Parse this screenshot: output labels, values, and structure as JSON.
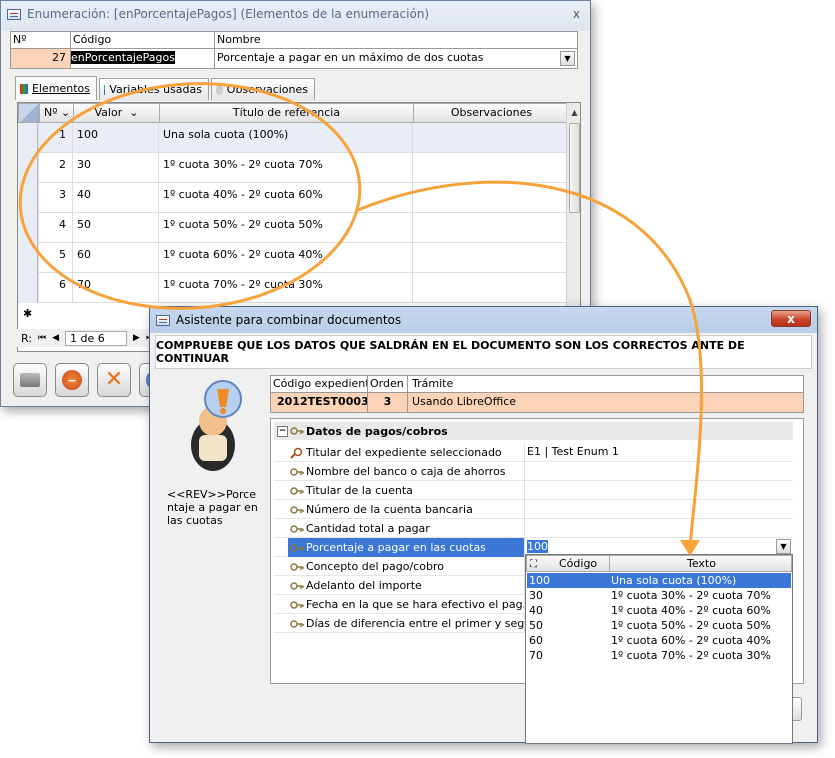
{
  "win1": {
    "title": "Enumeración: [enPorcentajePagos] (Elementos de la enumeración)",
    "close": "x",
    "header_cols": [
      "Nº",
      "Código",
      "Nombre"
    ],
    "record": {
      "num": "27",
      "code": "enPorcentajePagos",
      "name": "Porcentaje a pagar en un máximo de dos cuotas"
    },
    "tabs": [
      "Elementos",
      "Variables usadas",
      "Observaciones"
    ],
    "grid_cols": [
      "Nº",
      "Valor",
      "Título de referencia",
      "Observaciones"
    ],
    "rows": [
      {
        "n": "1",
        "valor": "100",
        "titulo": "Una sola cuota (100%)"
      },
      {
        "n": "2",
        "valor": "30",
        "titulo": "1º cuota 30% - 2º cuota 70%"
      },
      {
        "n": "3",
        "valor": "40",
        "titulo": "1º cuota 40% - 2º cuota 60%"
      },
      {
        "n": "4",
        "valor": "50",
        "titulo": "1º cuota 50% - 2º cuota 50%"
      },
      {
        "n": "5",
        "valor": "60",
        "titulo": "1º cuota 60% - 2º cuota 40%"
      },
      {
        "n": "6",
        "valor": "70",
        "titulo": "1º cuota 70% - 2º cuota 30%"
      }
    ],
    "new_row_marker": "✱",
    "nav": {
      "label": "R:",
      "position": "1 de 6"
    }
  },
  "win2": {
    "title": "Asistente para combinar documentos",
    "close": "x",
    "banner": "COMPRUEBE QUE LOS DATOS QUE SALDRÁN EN EL DOCUMENTO SON LOS CORRECTOS ANTE DE CONTINUAR",
    "side_text": "<<REV>>Porcentaje a pagar en las cuotas",
    "exp_cols": [
      "Código expediente",
      "Orden",
      "Trámite"
    ],
    "exp": {
      "code": "2012TEST0003",
      "orden": "3",
      "tramite": "Usando LibreOffice"
    },
    "group_toggle": "−",
    "group_title": "Datos de pagos/cobros",
    "fields": [
      {
        "label": "Titular del expediente seleccionado",
        "value": "E1 | Test Enum 1",
        "icon": "search-icon"
      },
      {
        "label": "Nombre del banco o caja de ahorros",
        "value": "",
        "icon": "key-icon"
      },
      {
        "label": "Titular de la cuenta",
        "value": "",
        "icon": "key-icon"
      },
      {
        "label": "Número de la cuenta bancaria",
        "value": "",
        "icon": "key-icon"
      },
      {
        "label": "Cantidad total a pagar",
        "value": "",
        "icon": "key-icon"
      },
      {
        "label": "Porcentaje a pagar en las cuotas",
        "value": "100",
        "icon": "key-icon"
      },
      {
        "label": "Concepto del pago/cobro",
        "value": "",
        "icon": "key-icon"
      },
      {
        "label": "Adelanto del importe",
        "value": "",
        "icon": "key-icon"
      },
      {
        "label": "Fecha en la que se hara efectivo el pag...",
        "value": "",
        "icon": "key-icon"
      },
      {
        "label": "Días de diferencia entre el primer y seg...",
        "value": "",
        "icon": "key-icon"
      }
    ],
    "dropdown": {
      "cols": [
        "Código",
        "Texto"
      ],
      "items": [
        {
          "code": "100",
          "text": "Una sola cuota (100%)"
        },
        {
          "code": "30",
          "text": "1º cuota 30% - 2º cuota 70%"
        },
        {
          "code": "40",
          "text": "1º cuota 40% - 2º cuota 60%"
        },
        {
          "code": "50",
          "text": "1º cuota 50% - 2º cuota 50%"
        },
        {
          "code": "60",
          "text": "1º cuota 60% - 2º cuota 40%"
        },
        {
          "code": "70",
          "text": "1º cuota 70% - 2º cuota 30%"
        }
      ]
    }
  },
  "colors": {
    "accent_orange": "#f7a23b",
    "highlight_row": "#fbd3b6",
    "selection_blue": "#3a77d6"
  }
}
